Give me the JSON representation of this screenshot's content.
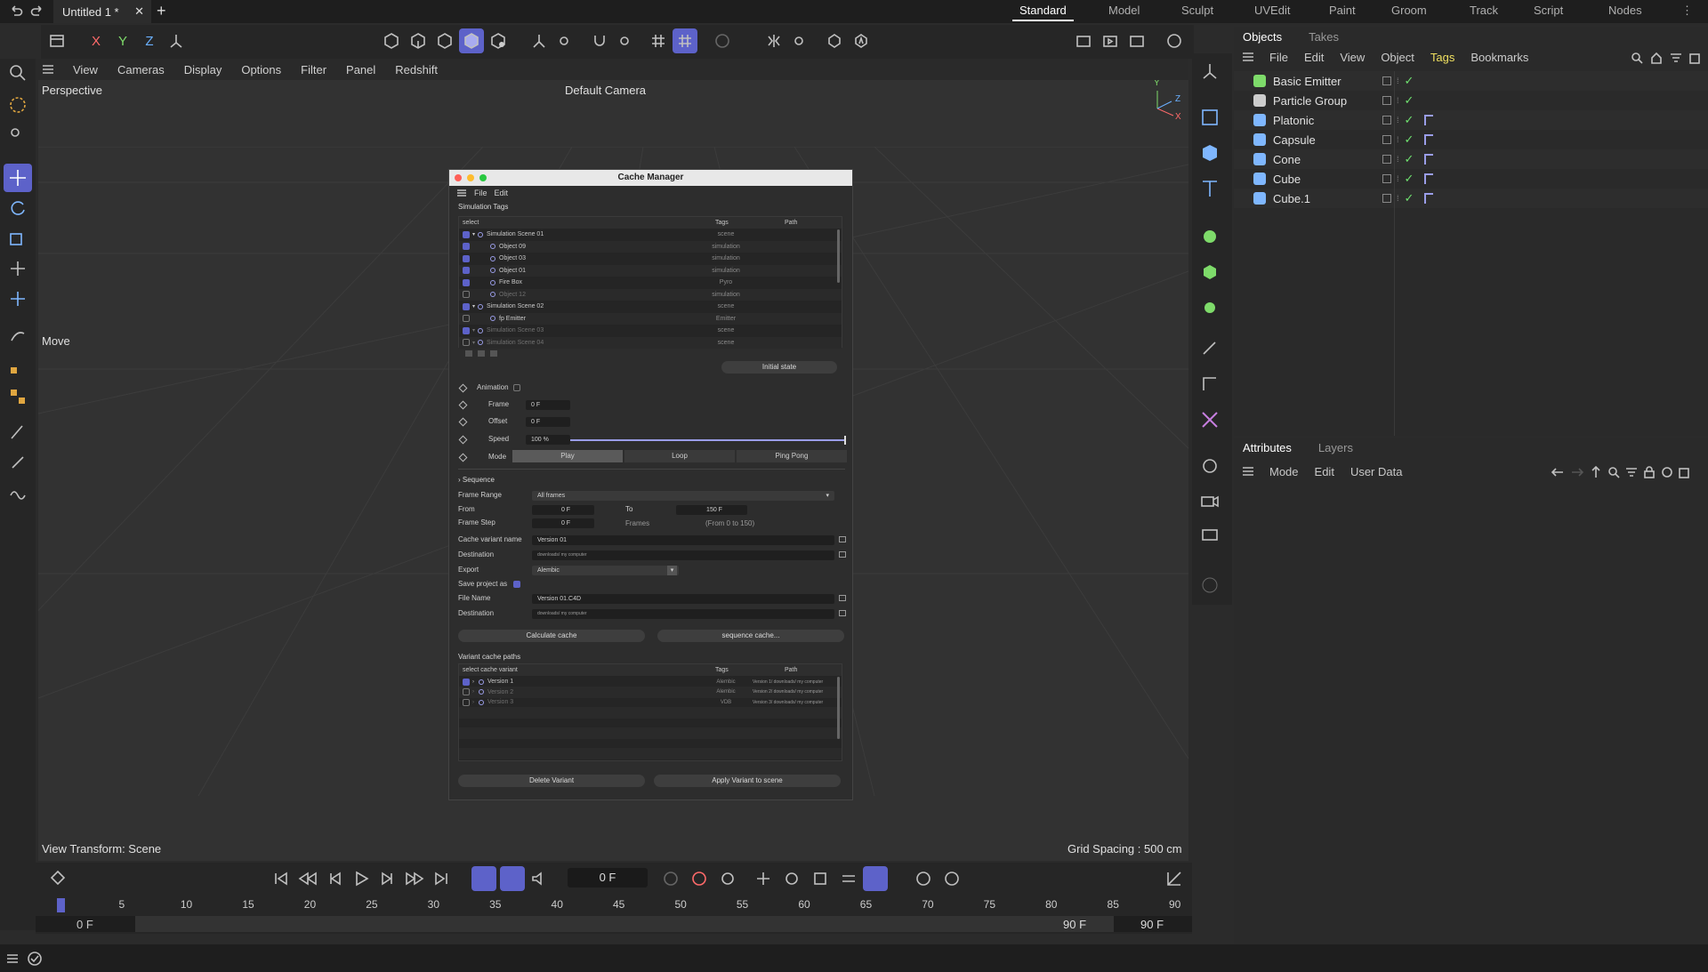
{
  "topbar": {
    "doc_tab": "Untitled 1 *",
    "layouts": [
      "Standard",
      "Model",
      "Sculpt",
      "UVEdit",
      "Paint",
      "Groom",
      "Track",
      "Script",
      "Nodes"
    ],
    "active_layout": "Standard"
  },
  "viewport": {
    "menu": [
      "View",
      "Cameras",
      "Display",
      "Options",
      "Filter",
      "Panel",
      "Redshift"
    ],
    "view_name": "Perspective",
    "camera": "Default Camera",
    "tool_label": "Move",
    "transform": "View Transform: Scene",
    "grid_spacing": "Grid Spacing : 500 cm",
    "axes": {
      "x": "X",
      "y": "Y",
      "z": "Z"
    }
  },
  "axis_buttons": {
    "x": "X",
    "y": "Y",
    "z": "Z"
  },
  "objects_panel": {
    "tabs": [
      "Objects",
      "Takes"
    ],
    "menu": [
      "File",
      "Edit",
      "View",
      "Object",
      "Tags",
      "Bookmarks"
    ],
    "active_menu": "Tags",
    "items": [
      {
        "name": "Basic Emitter",
        "icon": "emitter-icon",
        "tag": false
      },
      {
        "name": "Particle Group",
        "icon": "folder-icon",
        "tag": false
      },
      {
        "name": "Platonic",
        "icon": "platonic-icon",
        "tag": true
      },
      {
        "name": "Capsule",
        "icon": "capsule-icon",
        "tag": true
      },
      {
        "name": "Cone",
        "icon": "cone-icon",
        "tag": true
      },
      {
        "name": "Cube",
        "icon": "cube-icon",
        "tag": true
      },
      {
        "name": "Cube.1",
        "icon": "cube-icon",
        "tag": true
      }
    ]
  },
  "attributes_panel": {
    "tabs": [
      "Attributes",
      "Layers"
    ],
    "menu": [
      "Mode",
      "Edit",
      "User Data"
    ]
  },
  "timeline": {
    "current_frame": "0 F",
    "ticks": [
      "0",
      "5",
      "10",
      "15",
      "20",
      "25",
      "30",
      "35",
      "40",
      "45",
      "50",
      "55",
      "60",
      "65",
      "70",
      "75",
      "80",
      "85",
      "90"
    ],
    "start": "0 F",
    "start2": "0 F",
    "end": "90 F",
    "end2": "90 F"
  },
  "dialog": {
    "title": "Cache Manager",
    "menu": [
      "File",
      "Edit"
    ],
    "sim_tags_label": "Simulation Tags",
    "table_headers": [
      "select",
      "Tags",
      "Path"
    ],
    "rows": [
      {
        "name": "Simulation Scene 01",
        "tag": "scene",
        "checked": true,
        "indent": 0,
        "dim": false
      },
      {
        "name": "Object 09",
        "tag": "simulation",
        "checked": true,
        "indent": 1,
        "dim": false
      },
      {
        "name": "Object 03",
        "tag": "simulation",
        "checked": true,
        "indent": 1,
        "dim": false
      },
      {
        "name": "Object 01",
        "tag": "simulation",
        "checked": true,
        "indent": 1,
        "dim": false
      },
      {
        "name": "Fire Box",
        "tag": "Pyro",
        "checked": true,
        "indent": 1,
        "dim": false
      },
      {
        "name": "Object 12",
        "tag": "simulation",
        "checked": false,
        "indent": 1,
        "dim": true
      },
      {
        "name": "Simulation Scene 02",
        "tag": "scene",
        "checked": true,
        "indent": 0,
        "dim": false
      },
      {
        "name": "fp Emitter",
        "tag": "Emitter",
        "checked": false,
        "indent": 1,
        "dim": false
      },
      {
        "name": "Simulation Scene 03",
        "tag": "scene",
        "checked": true,
        "indent": 0,
        "dim": true
      },
      {
        "name": "Simulation Scene 04",
        "tag": "scene",
        "checked": false,
        "indent": 0,
        "dim": true
      }
    ],
    "initial_state": "Initial state",
    "animation_label": "Animation",
    "frame_label": "Frame",
    "frame_value": "0 F",
    "offset_label": "Offset",
    "offset_value": "0 F",
    "speed_label": "Speed",
    "speed_value": "100 %",
    "mode_label": "Mode",
    "modes": [
      "Play",
      "Loop",
      "Ping Pong"
    ],
    "active_mode": "Play",
    "sequence_label": "Sequence",
    "frame_range_label": "Frame Range",
    "frame_range_value": "All frames",
    "from_label": "From",
    "from_value": "0 F",
    "to_label": "To",
    "to_value": "150 F",
    "frame_step_label": "Frame Step",
    "frame_step_value": "0 F",
    "frames_label": "Frames",
    "frames_range_text": "(From 0 to 150)",
    "cache_variant_label": "Cache variant name",
    "cache_variant_value": "Version 01",
    "destination_label": "Destination",
    "destination_value": "downloads/ my computer",
    "export_label": "Export",
    "export_value": "Alembic",
    "save_project_label": "Save project as",
    "file_name_label": "File Name",
    "file_name_value": "Version 01.C4D",
    "destination2_value": "downloads/ my computer",
    "calc_button": "Calculate cache",
    "seq_button": "sequence cache...",
    "variant_paths_label": "Variant cache paths",
    "variant_headers": [
      "select cache variant",
      "Tags",
      "Path"
    ],
    "variants": [
      {
        "name": "Version 1",
        "tag": "Alembic",
        "path": "Version 1/ downloads/ my computer",
        "checked": true
      },
      {
        "name": "Version 2",
        "tag": "Alembic",
        "path": "Version 2/ downloads/ my computer",
        "checked": false
      },
      {
        "name": "Version 3",
        "tag": "VDB",
        "path": "Version 3/ downloads/ my computer",
        "checked": false
      }
    ],
    "delete_button": "Delete Variant",
    "apply_button": "Apply Variant to scene"
  }
}
